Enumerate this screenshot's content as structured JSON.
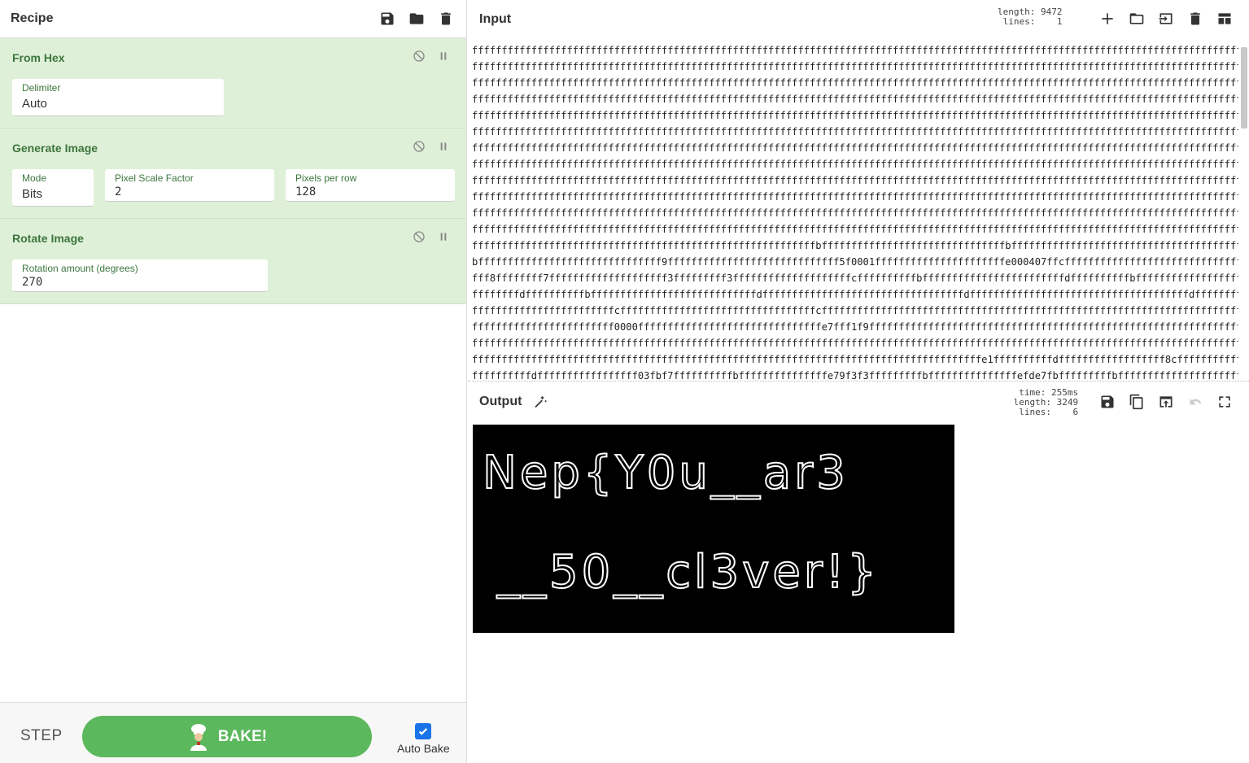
{
  "recipe": {
    "title": "Recipe",
    "operations": [
      {
        "title": "From Hex",
        "fields": [
          {
            "label": "Delimiter",
            "value": "Auto"
          }
        ]
      },
      {
        "title": "Generate Image",
        "fields": [
          {
            "label": "Mode",
            "value": "Bits"
          },
          {
            "label": "Pixel Scale Factor",
            "value": "2"
          },
          {
            "label": "Pixels per row",
            "value": "128"
          }
        ]
      },
      {
        "title": "Rotate Image",
        "fields": [
          {
            "label": "Rotation amount (degrees)",
            "value": "270"
          }
        ]
      }
    ],
    "icons": [
      "save-icon",
      "folder-icon",
      "trash-icon"
    ]
  },
  "controls": {
    "step_label": "STEP",
    "bake_label": "BAKE!",
    "auto_bake_label": "Auto Bake",
    "auto_bake_checked": true
  },
  "input": {
    "title": "Input",
    "stats": "length: 9472\n lines:    1",
    "lines": [
      "ffffffffffffffffffffffffffffffffffffffffffffffffffffffffffffffffffffffffffffffffffffffffffffffffffffffffffffffffffffffffffffffffffff",
      "ffffffffffffffffffffffffffffffffffffffffffffffffffffffffffffffffffffffffffffffffffffffffffffffffffffffffffffffffffffffffffffffffffff",
      "ffffffffffffffffffffffffffffffffffffffffffffffffffffffffffffffffffffffffffffffffffffffffffffffffffffffffffffffffffffffffffffffffffff",
      "ffffffffffffffffffffffffffffffffffffffffffffffffffffffffffffffffffffffffffffffffffffffffffffffffffffffffffffffffffffffffffffffffffff",
      "ffffffffffffffffffffffffffffffffffffffffffffffffffffffffffffffffffffffffffffffffffffffffffffffffffffffffffffffffffffffffffffffffffff",
      "ffffffffffffffffffffffffffffffffffffffffffffffffffffffffffffffffffffffffffffffffffffffffffffffffffffffffffffffffffffffffffffffffffff",
      "ffffffffffffffffffffffffffffffffffffffffffffffffffffffffffffffffffffffffffffffffffffffffffffffffffffffffffffffffffffffffffffffffffff",
      "ffffffffffffffffffffffffffffffffffffffffffffffffffffffffffffffffffffffffffffffffffffffffffffffffffffffffffffffffffffffffffffffffffff",
      "ffffffffffffffffffffffffffffffffffffffffffffffffffffffffffffffffffffffffffffffffffffffffffffffffffffffffffffffffffffffffffffffffffff",
      "ffffffffffffffffffffffffffffffffffffffffffffffffffffffffffffffffffffffffffffffffffffffffffffffffffffffffffffffffffffffffffffffffffff",
      "ffffffffffffffffffffffffffffffffffffffffffffffffffffffffffffffffffffffffffffffffffffffffffffffffffffffffffffffffffffffffffffffffffff",
      "ffffffffffffffffffffffffffffffffffffffffffffffffffffffffffffffffffffffffffffffffffffffffffffffffffffffffffffffffffffffffffffffffffff",
      "ffffffffffffffffffffffffffffffffffffffffffffffffffffffffffbfffffffffffffffffffffffffffffffbfffffffffffffffffffffffffffffffffffffffff",
      "bfffffffffffffffffffffffffffffff9fffffffffffffffffffffffffffff5f0001ffffffffffffffffffffffe000407ffcffffffffffffffffffffffffffffffff",
      "fff8ffffffff7ffffffffffffffffffff3fffffffff3ffffffffffffffffffffcffffffffffbffffffffffffffffffffffffdffffffffffbfffffffffffffffffffff",
      "ffffffffdffffffffffbffffffffffffffffffffffffffffdffffffffffffffffffffffffffffffffffdfffffffffffffffffffffffffffffffffffffdffffffffffff",
      "ffffffffffffffffffffffffcfffffffffffffffffffffffffffffffffcffffffffffffffffffffffffffffffffffffffffffffffffffffffffffffffffffffffffff",
      "ffffffffffffffffffffffff0000fffffffffffffffffffffffffffffffe7fff1f9fffffffffffffffffffffffffffffffffffffffffffffffffffffffffffffffffff",
      "ffffffffffffffffffffffffffffffffffffffffffffffffffffffffffffffffffffffffffffffffffffffffffffffffffffffffffffffffffffffffffffffffffff",
      "ffffffffffffffffffffffffffffffffffffffffffffffffffffffffffffffffffffffffffffffffffffffe1ffffffffffdffffffffffffffffff8cfffffffffffffff",
      "ffffffffffdfffffffffffffffff03fbf7ffffffffffbfffffffffffffffe79f3f3fffffffffbfffffffffffffffefde7fbfffffffffbffffffffffffffffffffffff"
    ]
  },
  "output": {
    "title": "Output",
    "stats": "  time: 255ms\nlength: 3249\n lines:    6",
    "image_text": [
      "Nep{Y0u__ar3",
      "__50__cl3ver!}"
    ]
  }
}
